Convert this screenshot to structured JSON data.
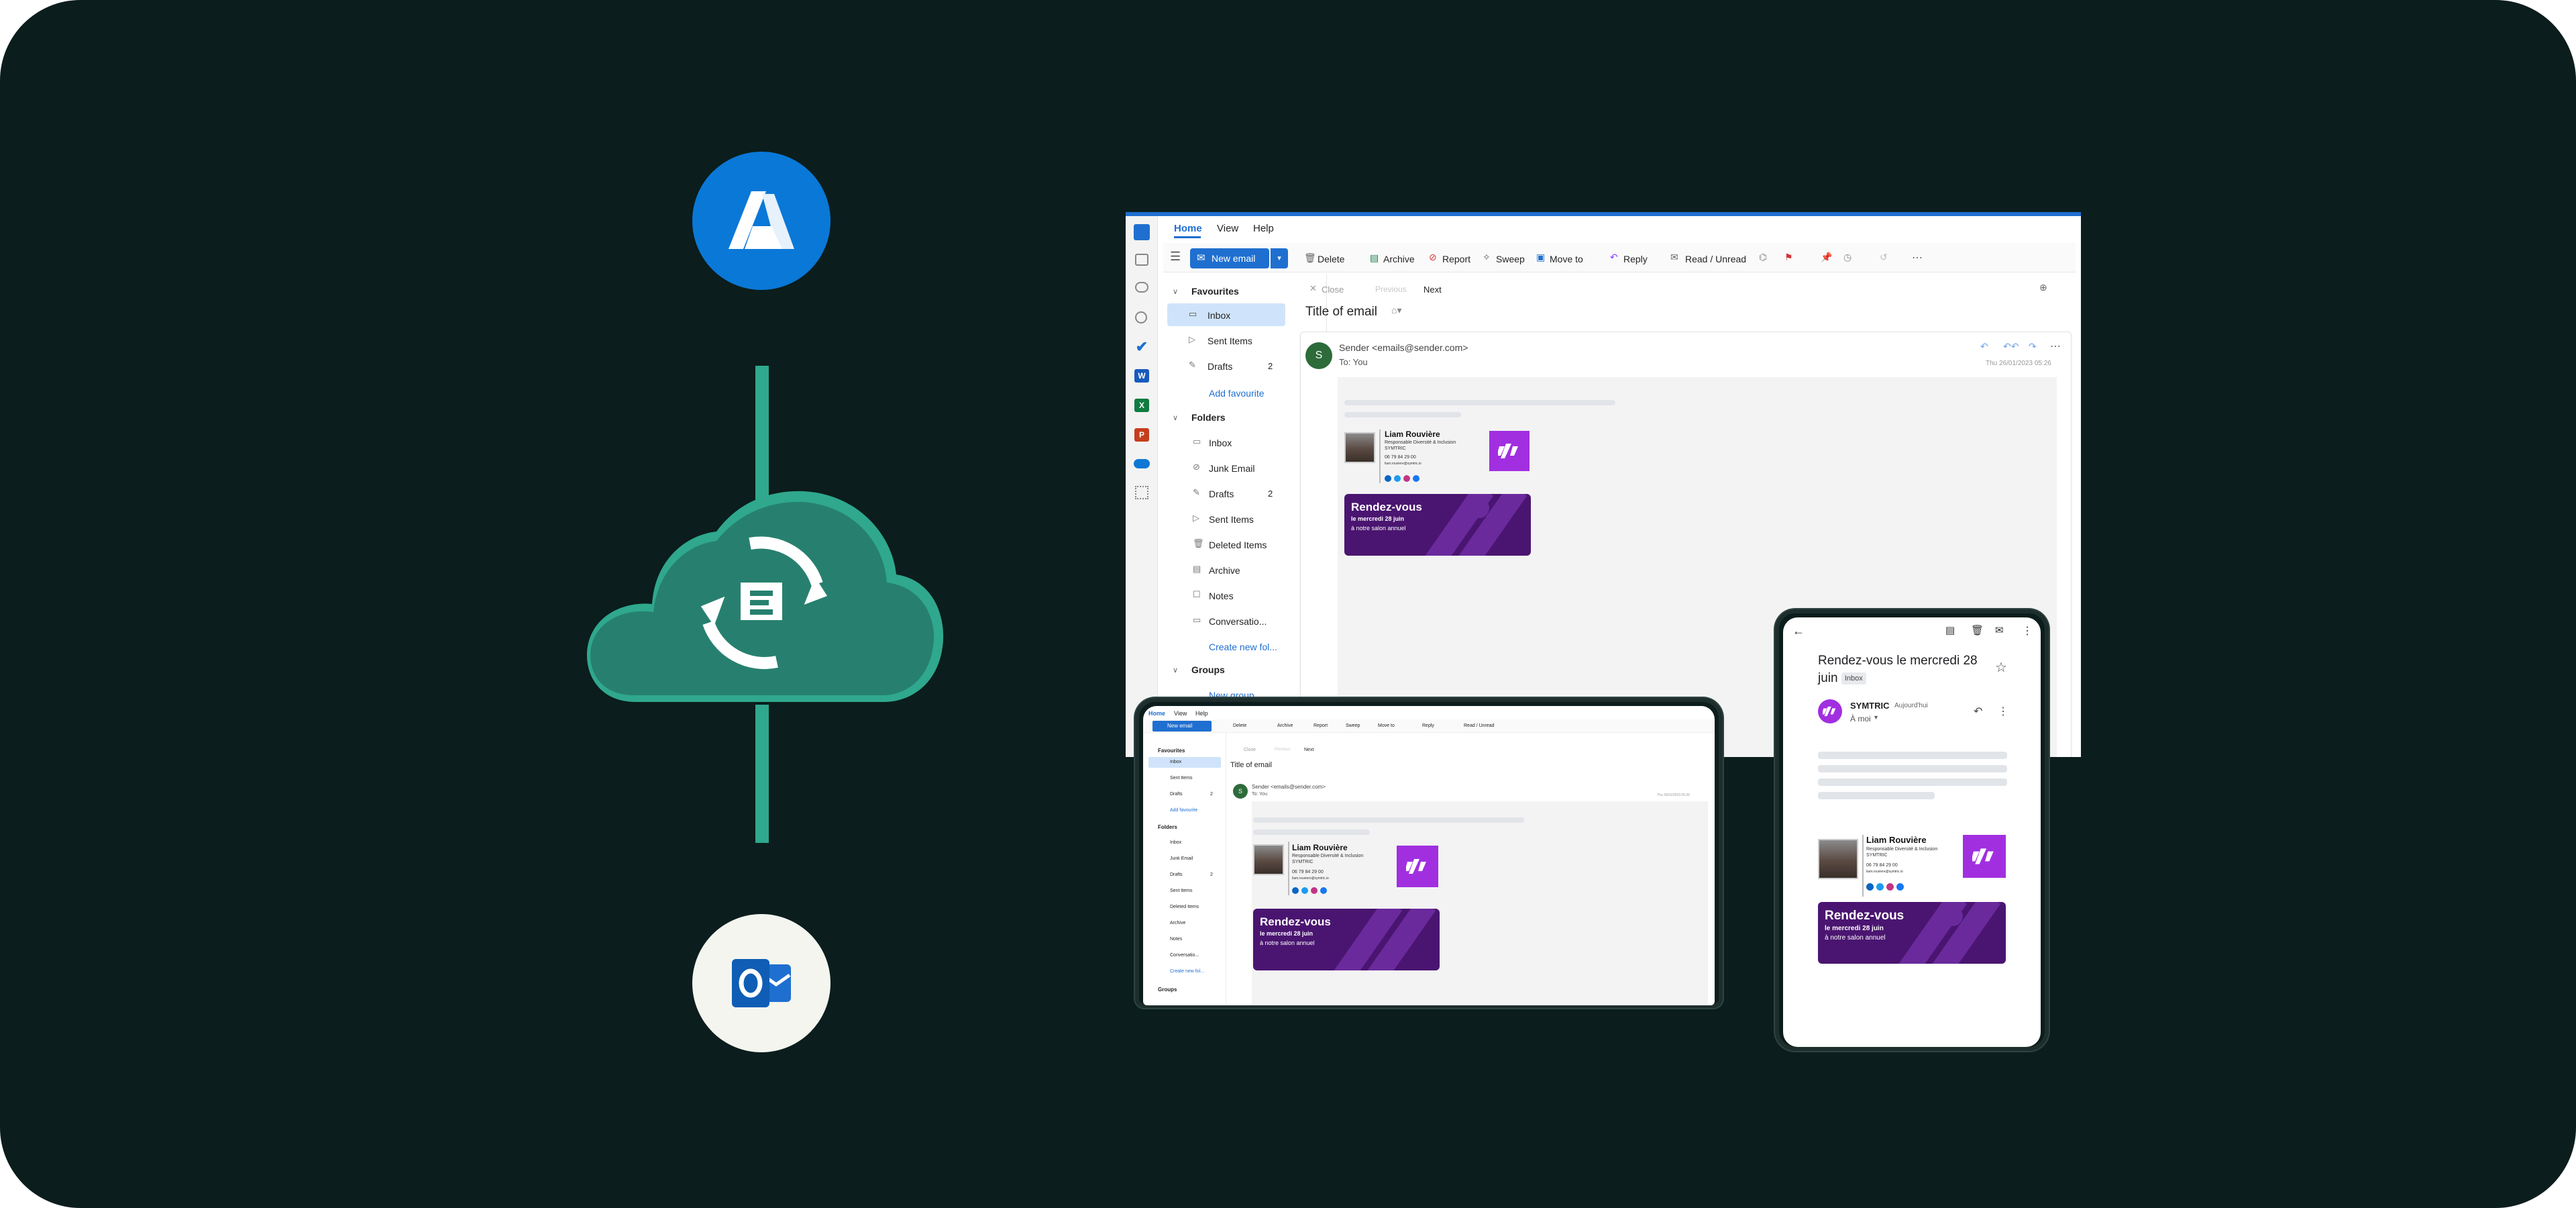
{
  "colors": {
    "bg": "#0b1d1c",
    "accent_teal": "#2fa88e",
    "cloud": "#2a8a78",
    "azure": "#0a78d7",
    "outlook_blue": "#1e6fd0",
    "purple": "#a12fe0",
    "banner": "#4a1570"
  },
  "icons": {
    "azure": "azure-logo-icon",
    "cloud": "cloud-sync-icon",
    "outlook": "outlook-logo-icon"
  },
  "desktop": {
    "tabs": [
      "Home",
      "View",
      "Help"
    ],
    "new_email": "New email",
    "toolbar": [
      "Delete",
      "Archive",
      "Report",
      "Sweep",
      "Move to",
      "Reply",
      "Read / Unread"
    ],
    "favourites_label": "Favourites",
    "favourites": [
      {
        "label": "Inbox"
      },
      {
        "label": "Sent Items"
      },
      {
        "label": "Drafts",
        "count": "2"
      }
    ],
    "add_favourite": "Add favourite",
    "folders_label": "Folders",
    "folders": [
      {
        "label": "Inbox"
      },
      {
        "label": "Junk Email"
      },
      {
        "label": "Drafts",
        "count": "2"
      },
      {
        "label": "Sent Items"
      },
      {
        "label": "Deleted Items"
      },
      {
        "label": "Archive"
      },
      {
        "label": "Notes"
      },
      {
        "label": "Conversatio..."
      }
    ],
    "create_folder": "Create new fol...",
    "groups_label": "Groups",
    "new_group": "New group",
    "nav_close": "Close",
    "nav_previous": "Previous",
    "nav_next": "Next",
    "subject": "Title of email",
    "avatar_letter": "S",
    "sender": "Sender <emails@sender.com>",
    "to": "To: You",
    "date": "Thu 26/01/2023 05:26"
  },
  "signature": {
    "name": "Liam Rouvière",
    "title": "Responsable Diversité & Inclusion",
    "company": "SYMTRIC",
    "phone": "06 79 84 29 00",
    "email": "liam.rouviere@symtric.io",
    "banner_title": "Rendez-vous",
    "banner_line1": "le mercredi 28 juin",
    "banner_line2": "à notre salon annuel"
  },
  "mobile": {
    "subject": "Rendez-vous le mercredi 28 juin",
    "badge": "Inbox",
    "sender": "SYMTRIC",
    "time": "Aujourd'hui",
    "to": "À moi"
  }
}
